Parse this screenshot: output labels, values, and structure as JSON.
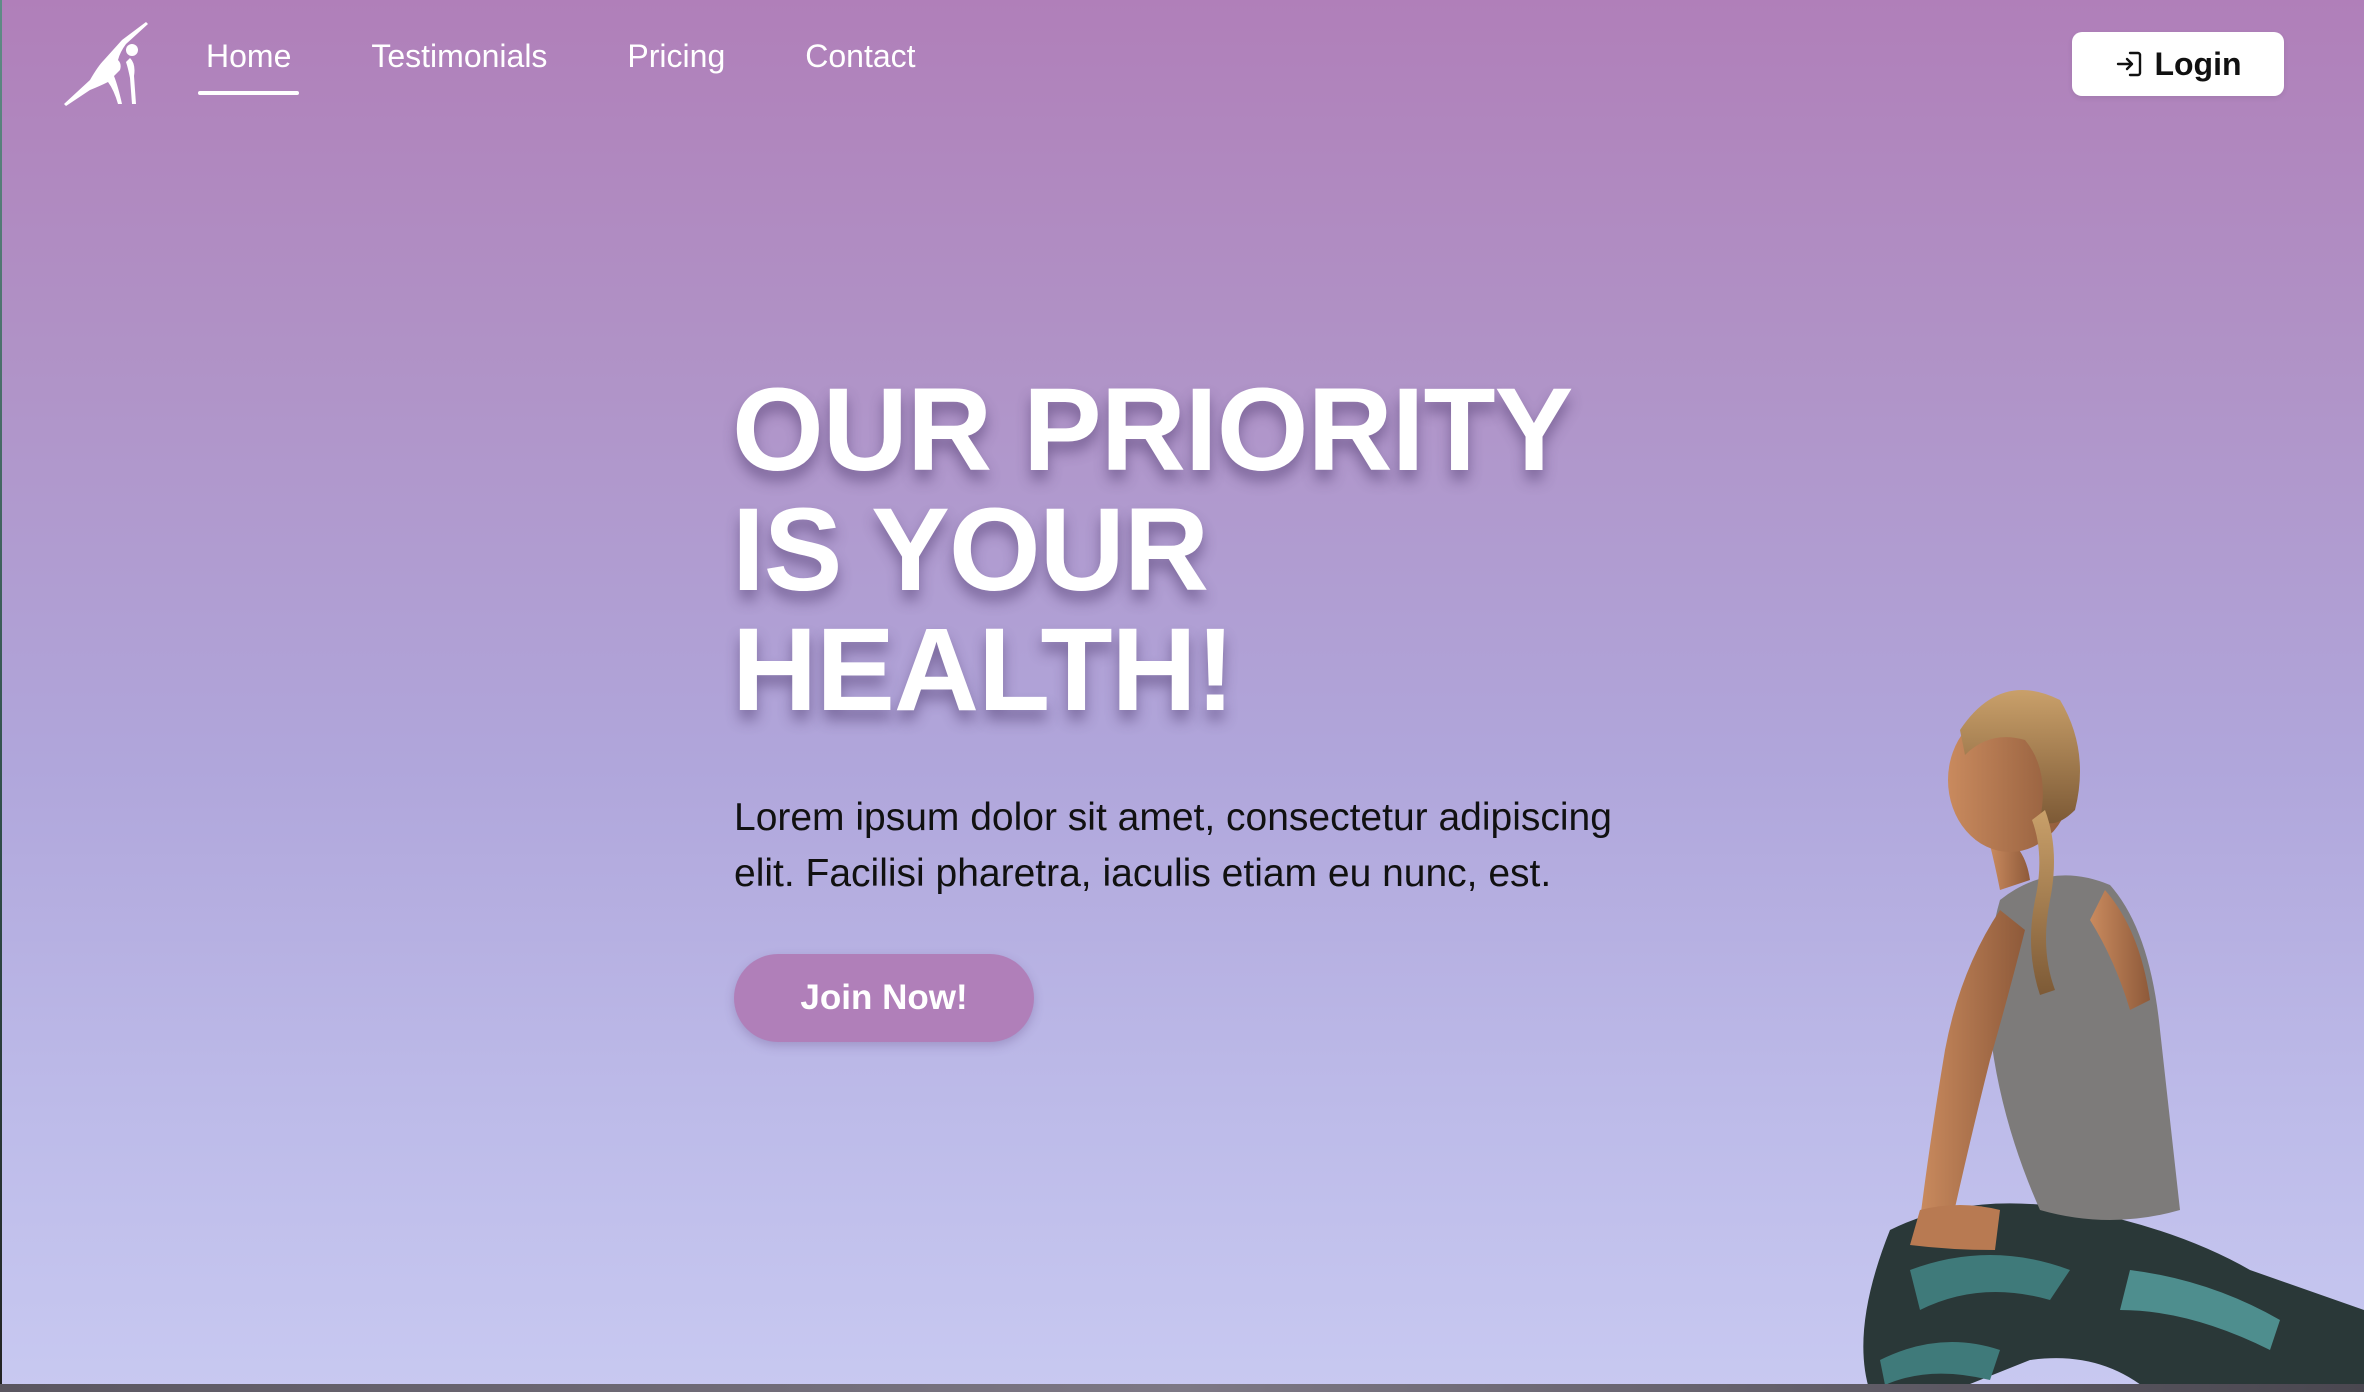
{
  "nav": {
    "items": [
      {
        "label": "Home",
        "active": true
      },
      {
        "label": "Testimonials",
        "active": false
      },
      {
        "label": "Pricing",
        "active": false
      },
      {
        "label": "Contact",
        "active": false
      }
    ],
    "login_label": "Login"
  },
  "hero": {
    "title_lines": [
      "OUR PRIORITY",
      "IS YOUR",
      "HEALTH!"
    ],
    "text_lines": [
      "Lorem ipsum dolor sit amet, consectetur adipiscing",
      "elit. Facilisi pharetra, iaculis etiam eu nunc, est."
    ],
    "cta_label": "Join Now!"
  },
  "icons": {
    "logo": "yoga-pose-logo-icon",
    "login": "login-arrow-icon"
  },
  "colors": {
    "accent": "#b07fb9",
    "gradient_top": "#b07fb9",
    "gradient_bottom": "#c8c9f1"
  }
}
